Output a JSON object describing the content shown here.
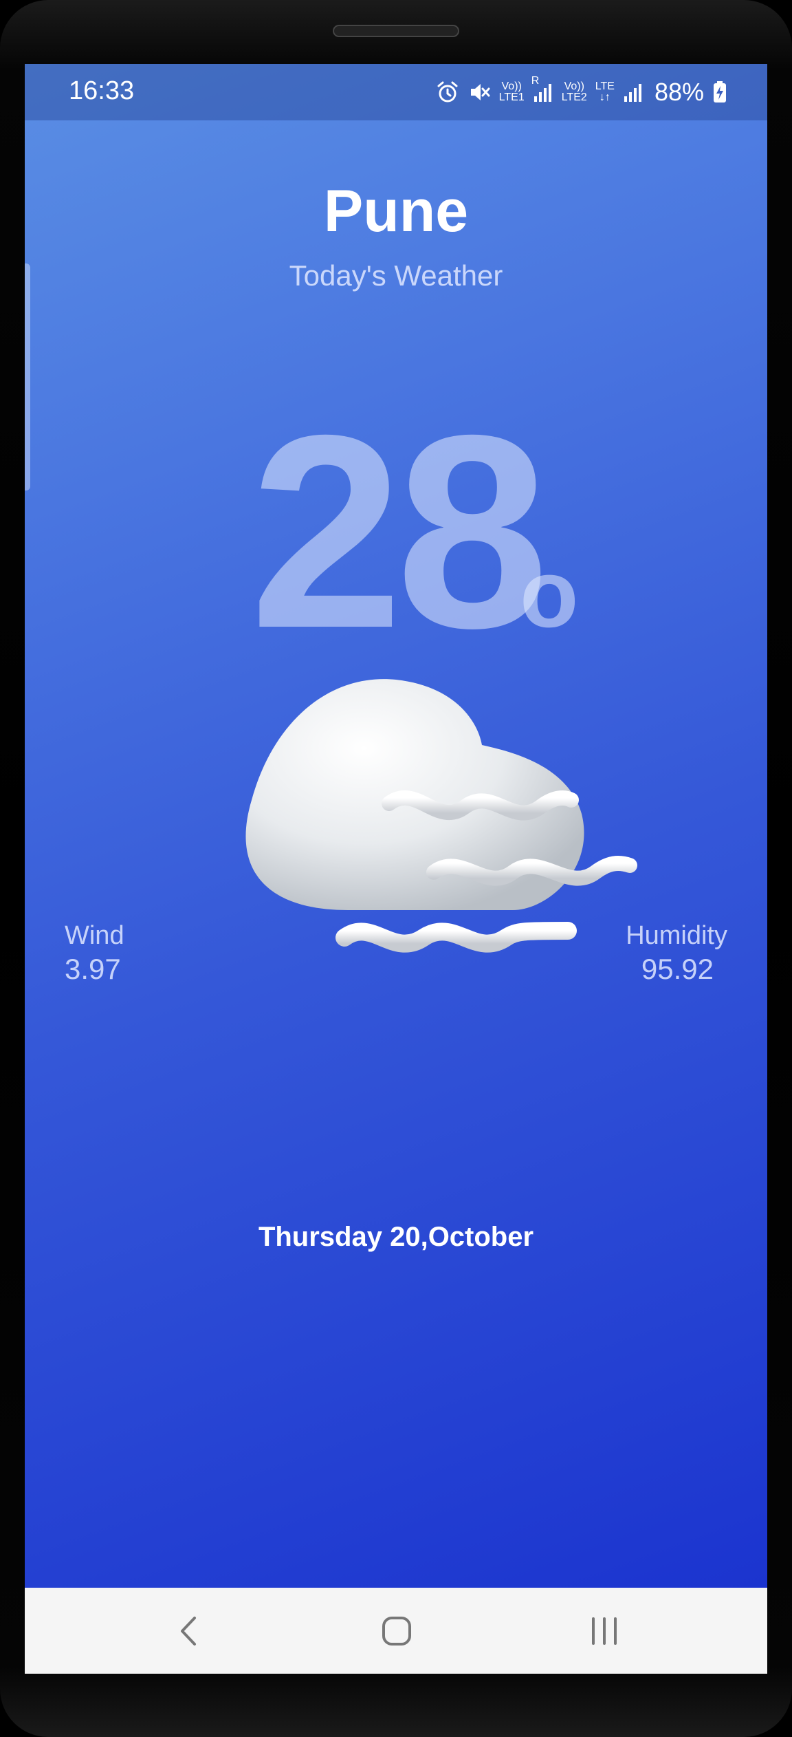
{
  "status_bar": {
    "time": "16:33",
    "sim1_label_top": "Vo))",
    "sim1_label_bottom": "LTE1",
    "roaming_label": "R",
    "sim2_label_top": "Vo))",
    "sim2_label_bottom": "LTE2",
    "network_type": "LTE",
    "battery_percent": "88%",
    "icons": [
      "alarm-icon",
      "mute-icon",
      "signal-icon",
      "battery-charging-icon"
    ]
  },
  "header": {
    "city": "Pune",
    "subtitle": "Today's Weather"
  },
  "current": {
    "temperature": "28",
    "degree_symbol": "o",
    "condition_icon": "fog-cloud-icon"
  },
  "stats": {
    "wind_label": "Wind",
    "wind_value": "3.97",
    "humidity_label": "Humidity",
    "humidity_value": "95.92"
  },
  "date": "Thursday 20,October",
  "nav": {
    "icons": [
      "back-icon",
      "home-icon",
      "recents-icon"
    ]
  },
  "colors": {
    "gradient_top": "#5a8ee4",
    "gradient_bottom": "#1b34cf",
    "navbar_bg": "#f5f5f5"
  }
}
